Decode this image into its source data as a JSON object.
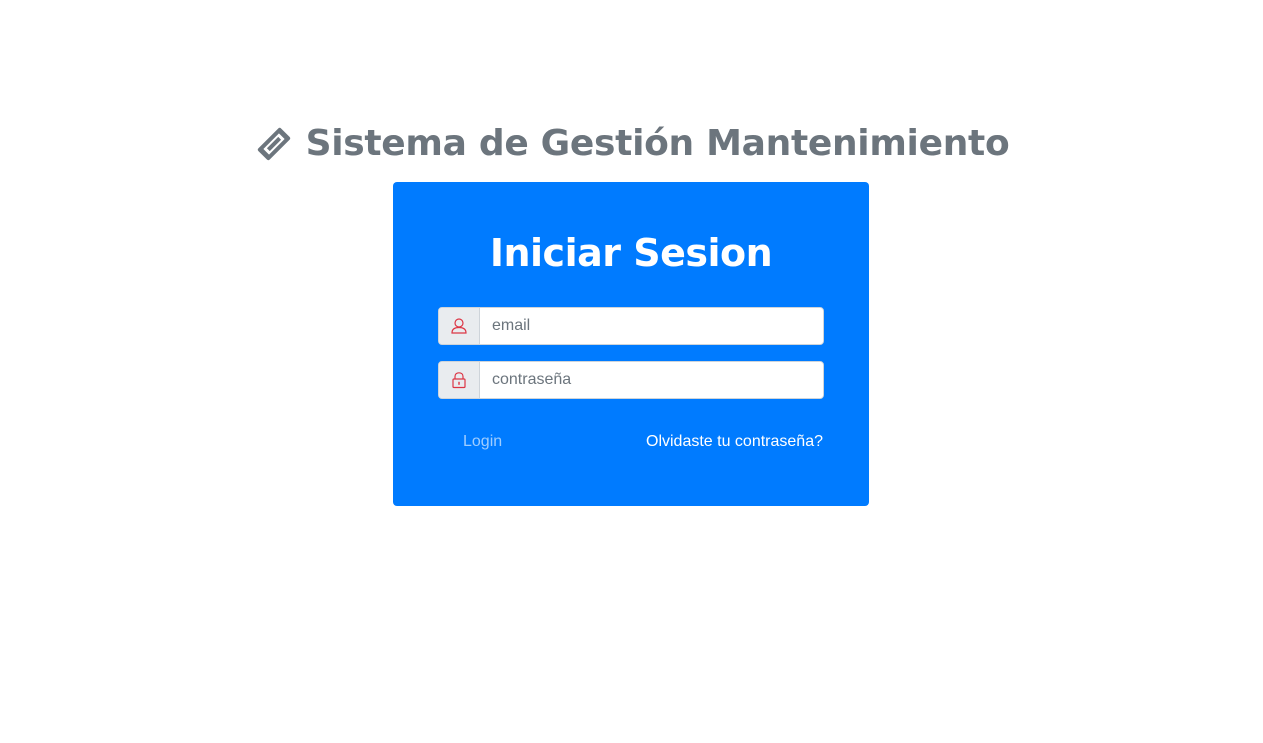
{
  "header": {
    "title": "Sistema de Gestión Mantenimiento",
    "icon": "ticket-icon"
  },
  "login_card": {
    "title": "Iniciar Sesion",
    "background_color": "#007bff",
    "email": {
      "icon": "user-icon",
      "placeholder": "email",
      "value": ""
    },
    "password": {
      "icon": "lock-icon",
      "placeholder": "contraseña",
      "value": ""
    },
    "login_label": "Login",
    "forgot_label": "Olvidaste tu contraseña?"
  },
  "colors": {
    "title_gray": "#6c757d",
    "icon_red": "#dc3545",
    "link_light_blue": "#9fcdff"
  }
}
